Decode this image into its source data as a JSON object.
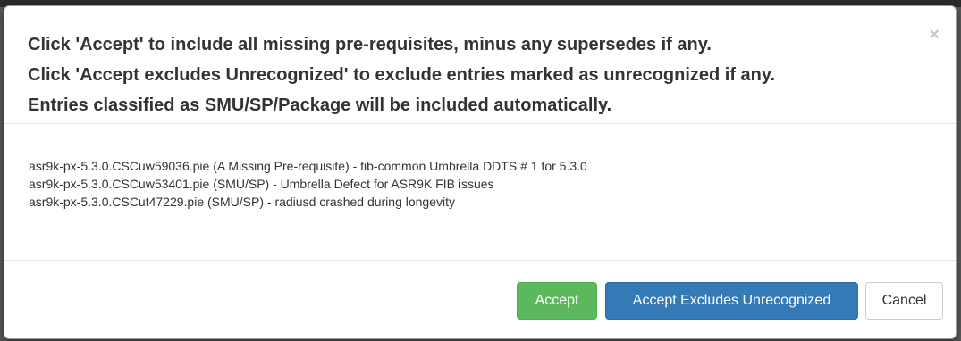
{
  "dialog": {
    "header_lines": [
      "Click 'Accept' to include all missing pre-requisites, minus any supersedes if any.",
      "Click 'Accept excludes Unrecognized' to exclude entries marked as unrecognized if any.",
      "Entries classified as SMU/SP/Package will be included automatically."
    ],
    "close_glyph": "×",
    "close_icon": "close-icon",
    "entries": [
      "asr9k-px-5.3.0.CSCuw59036.pie (A Missing Pre-requisite) - fib-common Umbrella DDTS # 1 for 5.3.0",
      "asr9k-px-5.3.0.CSCuw53401.pie (SMU/SP) - Umbrella Defect for ASR9K FIB issues",
      "asr9k-px-5.3.0.CSCut47229.pie (SMU/SP) - radiusd crashed during longevity"
    ],
    "buttons": {
      "accept": "Accept",
      "accept_excludes": "Accept Excludes Unrecognized",
      "cancel": "Cancel"
    }
  },
  "colors": {
    "accept": "#5cb85c",
    "accept_excludes": "#337ab7",
    "cancel": "#ffffff",
    "text": "#333333"
  }
}
